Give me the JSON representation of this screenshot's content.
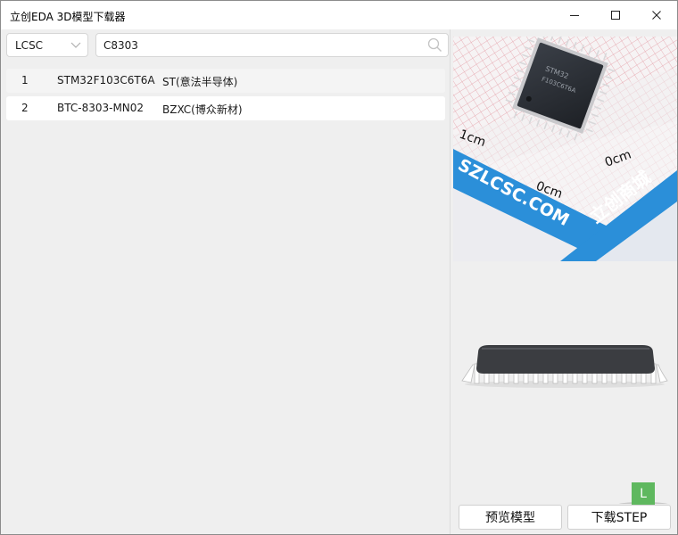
{
  "window": {
    "title": "立创EDA 3D模型下载器"
  },
  "source_select": {
    "value": "LCSC"
  },
  "search": {
    "value": "C8303"
  },
  "results": [
    {
      "index": "1",
      "part": "STM32F103C6T6A",
      "manufacturer": "ST(意法半导体)"
    },
    {
      "index": "2",
      "part": "BTC-8303-MN02",
      "manufacturer": "BZXC(博众新材)"
    }
  ],
  "photo": {
    "ruler_labels": [
      "1cm",
      "0cm",
      "0cm"
    ],
    "watermark_text": "SZLCSC.COM",
    "brand_text": "立创商城",
    "chip_text": [
      "STM32",
      "F103C6T6A"
    ]
  },
  "viewer": {
    "axis_label": "L"
  },
  "buttons": {
    "preview": "预览模型",
    "download": "下载STEP"
  },
  "colors": {
    "accent": "#2b8fd9",
    "chip": "#2a2d33",
    "axis": "#5fb85f"
  }
}
